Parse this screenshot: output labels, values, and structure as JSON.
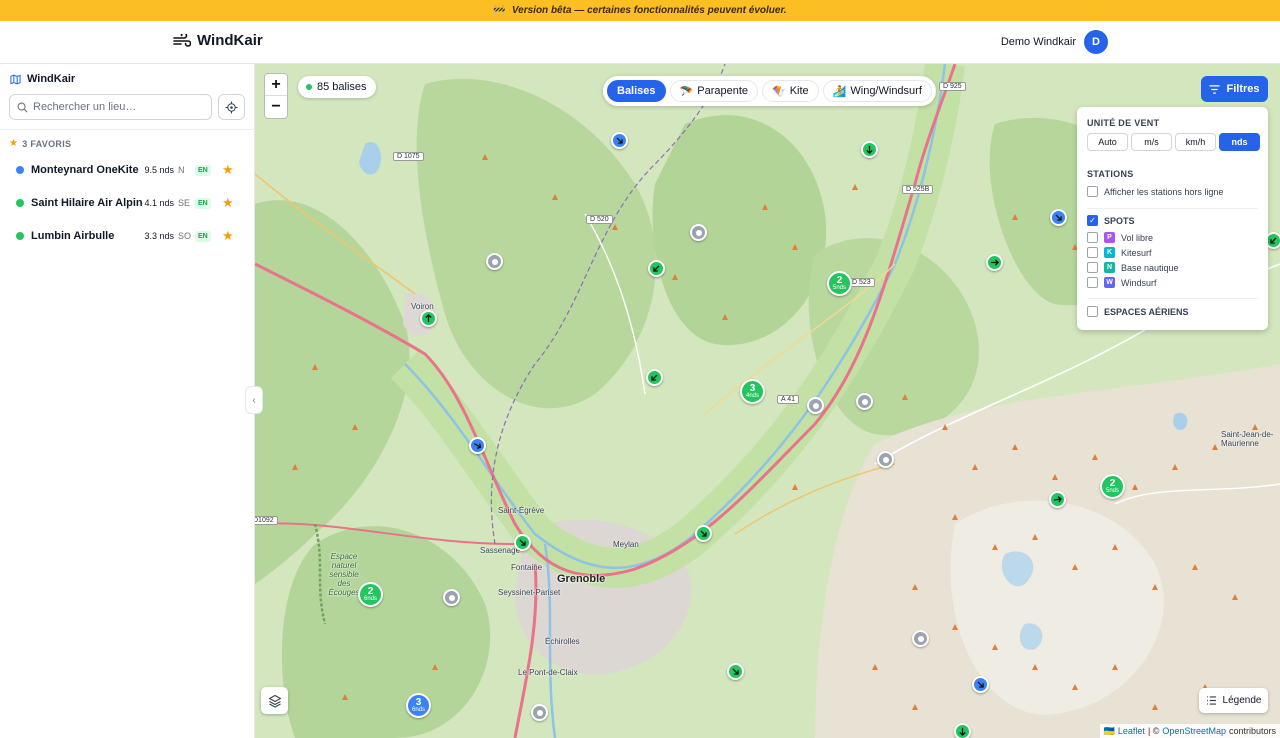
{
  "banner": {
    "icon": "construction-icon",
    "text": "Version bêta — certaines fonctionnalités peuvent évoluer."
  },
  "header": {
    "brand": "WindKair",
    "user_name": "Demo Windkair",
    "avatar_initial": "D"
  },
  "sidebar": {
    "title": "WindKair",
    "search_placeholder": "Rechercher un lieu…",
    "favorites_header": "3 FAVORIS",
    "favorites": [
      {
        "name": "Monteynard OneKite",
        "speed": "9.5 nds",
        "dir": "N",
        "tag": "EN",
        "color": "#3b82f6"
      },
      {
        "name": "Saint Hilaire Air Alpin",
        "speed": "4.1 nds",
        "dir": "SE",
        "tag": "EN",
        "color": "#22c55e"
      },
      {
        "name": "Lumbin Airbulle",
        "speed": "3.3 nds",
        "dir": "SO",
        "tag": "EN",
        "color": "#22c55e"
      }
    ]
  },
  "map": {
    "zoom_in": "+",
    "zoom_out": "−",
    "stations_count": "85 balises",
    "tabs": [
      {
        "label": "Balises",
        "icon": "",
        "active": true
      },
      {
        "label": "Parapente",
        "icon": "🪂",
        "active": false
      },
      {
        "label": "Kite",
        "icon": "🪁",
        "active": false
      },
      {
        "label": "Wing/Windsurf",
        "icon": "🏄",
        "active": false
      }
    ],
    "filters_button": "Filtres",
    "filters": {
      "wind_unit_title": "UNITÉ DE VENT",
      "units": [
        {
          "label": "Auto",
          "active": false
        },
        {
          "label": "m/s",
          "active": false
        },
        {
          "label": "km/h",
          "active": false
        },
        {
          "label": "nds",
          "active": true
        }
      ],
      "stations_title": "STATIONS",
      "offline_label": "Afficher les stations hors ligne",
      "spots_title": "SPOTS",
      "spots": [
        {
          "letter": "P",
          "label": "Vol libre",
          "color": "#a855f7"
        },
        {
          "letter": "K",
          "label": "Kitesurf",
          "color": "#06b6d4"
        },
        {
          "letter": "N",
          "label": "Base nautique",
          "color": "#14b8a6"
        },
        {
          "letter": "W",
          "label": "Windsurf",
          "color": "#6366f1"
        }
      ],
      "airspace_title": "ESPACES AÉRIENS"
    },
    "legend_button": "Légende",
    "attribution": {
      "leaflet": "Leaflet",
      "sep": "| ©",
      "osm": "OpenStreetMap",
      "contrib": "contributors"
    },
    "towns": [
      "Voiron",
      "Saint-Égrève",
      "Sassenage",
      "Fontaine",
      "Grenoble",
      "Meylan",
      "Seyssinet-Pariset",
      "Échirolles",
      "Le Pont-de-Claix",
      "Saint-Jean-de-Maurienne"
    ],
    "nature_label": "Espace naturel sensible des Écouges",
    "roads": [
      "D 1075",
      "D 520",
      "D 525B",
      "D 523",
      "A 41",
      "D 925",
      "D1092"
    ],
    "clusters": [
      {
        "count": "2",
        "unit": "5nds"
      },
      {
        "count": "3",
        "unit": "4nds"
      },
      {
        "count": "2",
        "unit": "5nds"
      },
      {
        "count": "2",
        "unit": "6nds"
      },
      {
        "count": "3",
        "unit": "6nds"
      }
    ]
  }
}
